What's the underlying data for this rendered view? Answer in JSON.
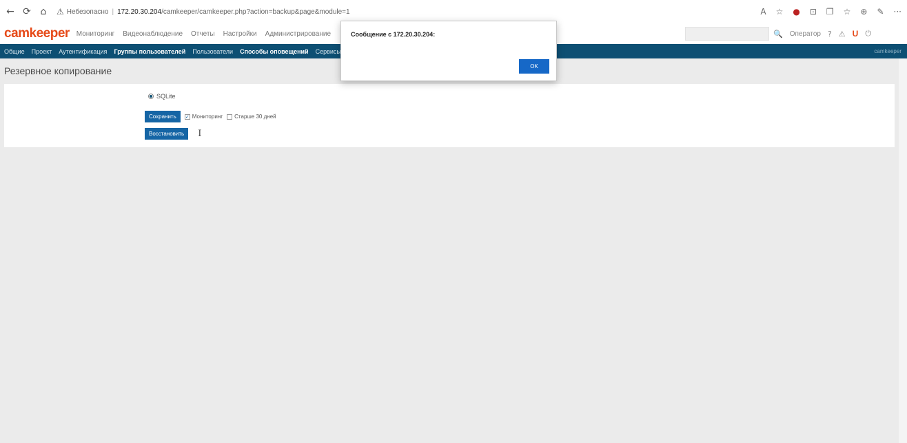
{
  "browser": {
    "back_icon": "←",
    "reload_icon": "⟳",
    "home_icon": "⌂",
    "warning_icon": "⚠",
    "security_label": "Небезопасно",
    "url_host": "172.20.30.204",
    "url_path": "/camkeeper/camkeeper.php?action=backup&page&module=1",
    "right_icons": [
      "A",
      "☆",
      "●",
      "⊡",
      "❐",
      "☆",
      "⊕",
      "✎",
      "···"
    ]
  },
  "app": {
    "logo": "camkeeper",
    "menu": [
      "Мониторинг",
      "Видеонаблюдение",
      "Отчеты",
      "Настройки",
      "Администрирование"
    ],
    "search_icon": "search-icon",
    "search_glyph": "🔍",
    "user_label": "Оператор",
    "header_icons": [
      "?",
      "⚠",
      "U",
      "⏻"
    ]
  },
  "subnav": {
    "items": [
      "Общие",
      "Проект",
      "Аутентификация",
      "Группы пользователей",
      "Пользователи",
      "Способы оповещений",
      "Сервисы"
    ],
    "active_index": 3,
    "right_label": "camkeeper"
  },
  "page": {
    "title": "Резервное копирование"
  },
  "backup": {
    "radio_label": "SQLite",
    "save_button": "Сохранить",
    "checkbox1_label": "Мониторинг",
    "checkbox1_checked": true,
    "checkbox2_label": "Старше 30 дней",
    "checkbox2_checked": false,
    "restore_button": "Восстановить"
  },
  "dialog": {
    "title": "Сообщение с 172.20.30.204:",
    "ok_button": "OK"
  }
}
